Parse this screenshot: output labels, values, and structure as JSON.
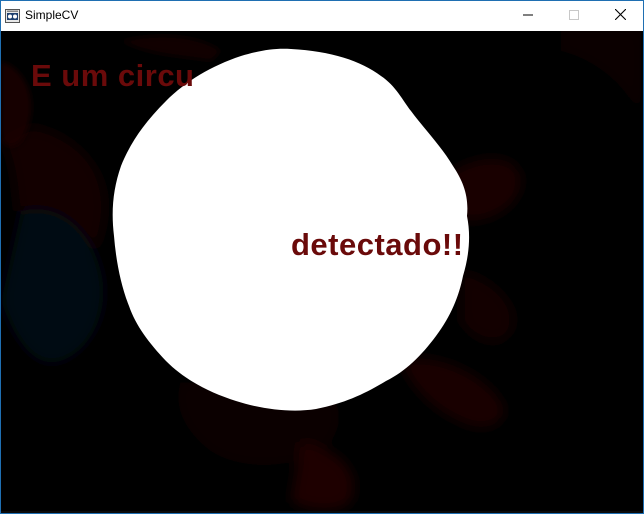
{
  "window": {
    "title": "SimpleCV",
    "app_icon": "simplecv-app-icon",
    "controls": [
      "minimize-icon",
      "maximize-icon",
      "close-icon"
    ]
  },
  "frame": {
    "caption_top": "E um circu",
    "caption_detected": "detectado!!",
    "caption_color": "#6a0a0a",
    "blob_color": "#ffffff",
    "background_color": "#000000"
  }
}
